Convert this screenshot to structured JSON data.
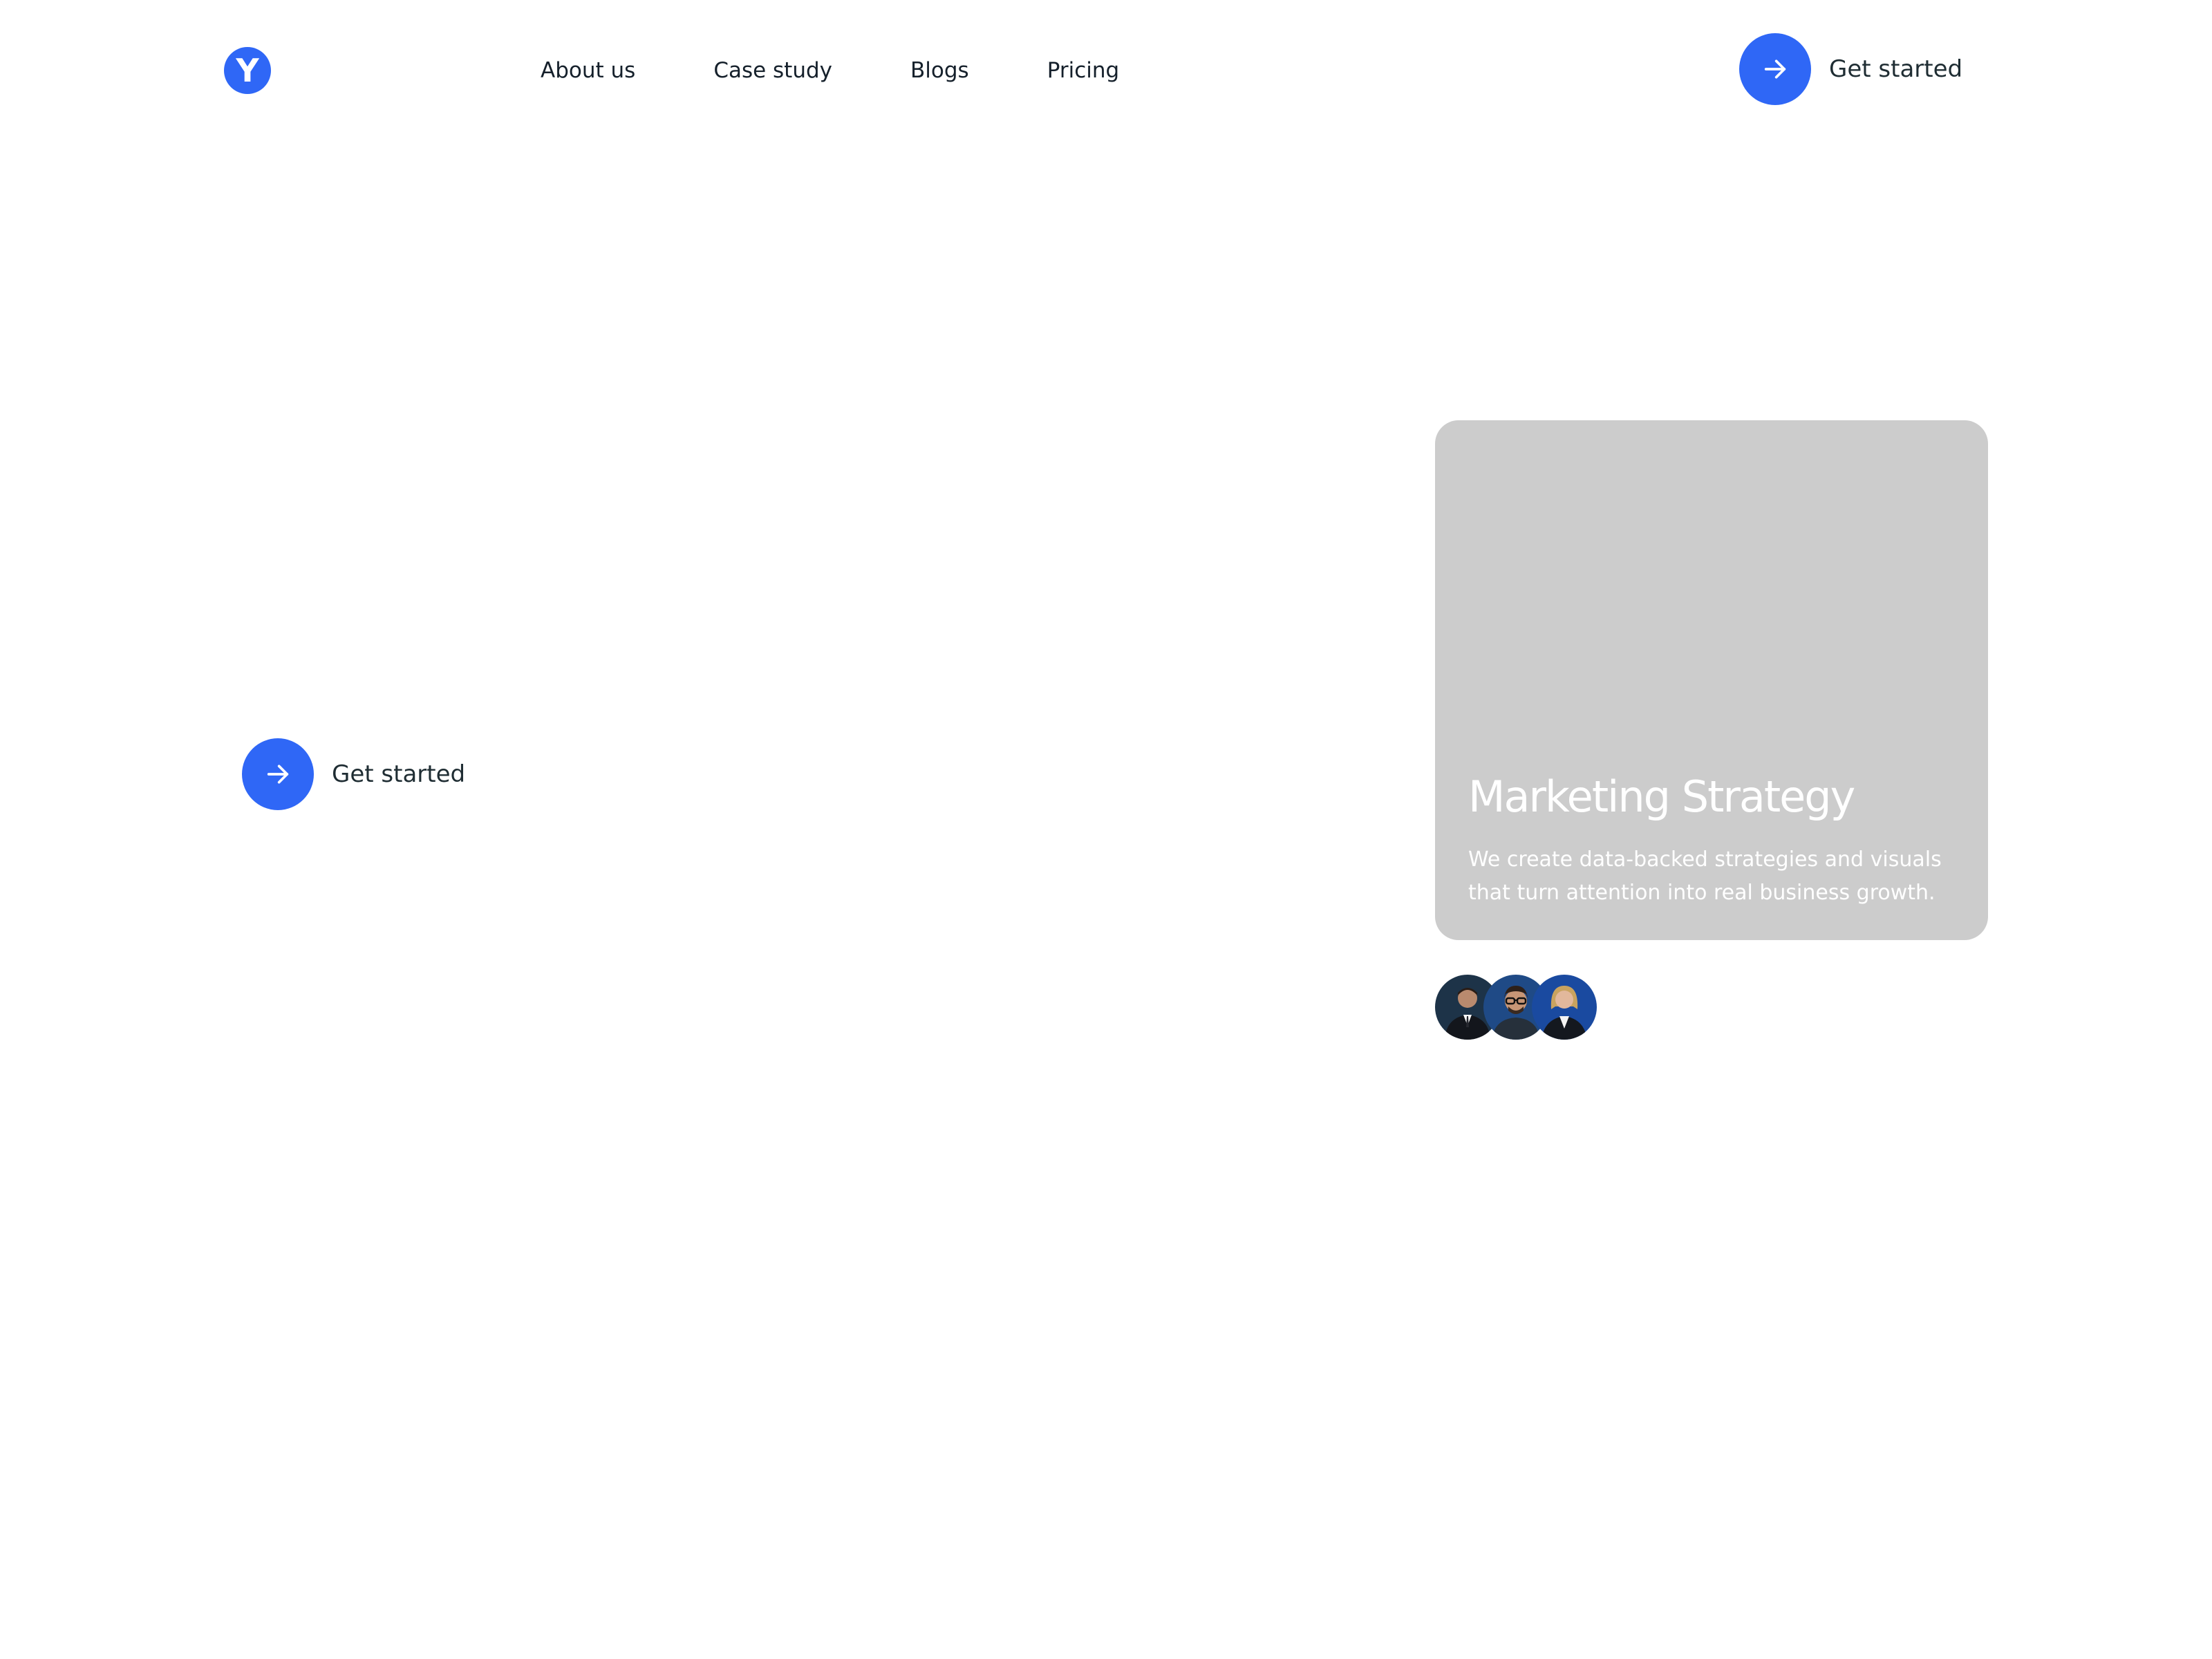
{
  "header": {
    "logo_letter": "Y",
    "nav": [
      {
        "label": "About us"
      },
      {
        "label": "Case study"
      },
      {
        "label": "Blogs"
      },
      {
        "label": "Pricing"
      }
    ],
    "cta_label": "Get started"
  },
  "hero": {
    "cta_label": "Get started"
  },
  "card": {
    "title": "Marketing Strategy",
    "description": "We create data-backed strategies and visuals that turn attention into real business growth."
  },
  "avatars": [
    {
      "icon": "person-avatar-icon"
    },
    {
      "icon": "person-avatar-icon"
    },
    {
      "icon": "person-avatar-icon"
    }
  ],
  "colors": {
    "accent": "#2f67f6",
    "card_bg": "#cccccc",
    "text": "#15202b"
  }
}
